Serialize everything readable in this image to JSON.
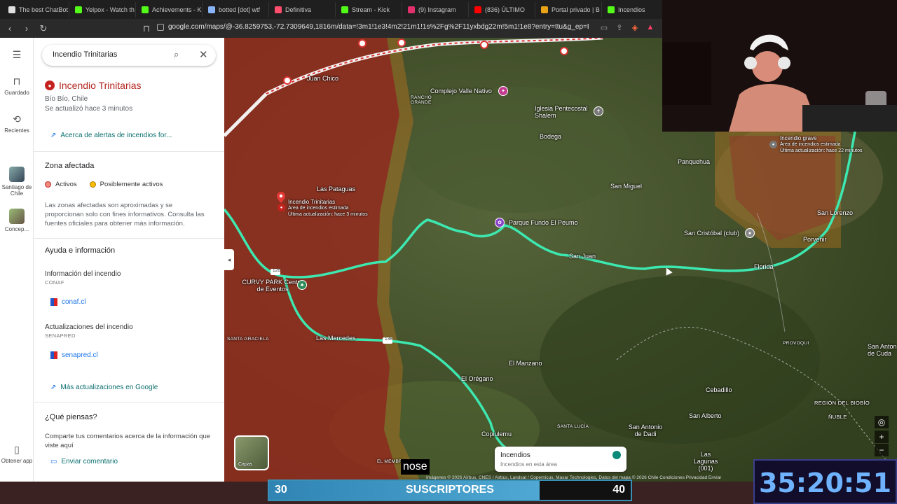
{
  "browser": {
    "tabs": [
      {
        "label": "The best ChatBot",
        "color": "#e0e0e0"
      },
      {
        "label": "Yelpox - Watch th",
        "color": "#53fc18"
      },
      {
        "label": "Achievements - K",
        "color": "#53fc18"
      },
      {
        "label": "botted [dot] wtf",
        "color": "#8ab4f8"
      },
      {
        "label": "Definitiva",
        "color": "#ff4d6d"
      },
      {
        "label": "Stream - Kick",
        "color": "#53fc18"
      },
      {
        "label": "(9) Instagram",
        "color": "#e1306c"
      },
      {
        "label": "(836) ÚLTIMO",
        "color": "#ff0000"
      },
      {
        "label": "Portal privado | B",
        "color": "#e8a317"
      },
      {
        "label": "Incendios",
        "color": "#53fc18"
      }
    ],
    "url": "google.com/maps/@-36.8259753,-72.7309649,1816m/data=!3m1!1e3!4m2!21m1!1s%2Fg%2F11yxbdg22m!5m1!1e8?entry=ttu&g_ep=EgoyMD..."
  },
  "rail": {
    "saved": "Guardado",
    "recent": "Recientes",
    "place1": "Santiago de Chile",
    "place2": "Concep...",
    "get_app": "Obtener app"
  },
  "panel": {
    "search_value": "Incendio Trinitarias",
    "title": "Incendio Trinitarias",
    "region": "Bío Bío, Chile",
    "updated": "Se actualizó hace 3 minutos",
    "about_link": "Acerca de alertas de incendios for...",
    "zone_heading": "Zona afectada",
    "legend_active": "Activos",
    "legend_possible": "Posiblemente activos",
    "disclaimer": "Las zonas afectadas son aproximadas y se proporcionan solo con fines informativos. Consulta las fuentes oficiales para obtener más información.",
    "help_heading": "Ayuda e información",
    "info1_title": "Información del incendio",
    "info1_src": "CONAF",
    "info1_link": "conaf.cl",
    "info2_title": "Actualizaciones del incendio",
    "info2_src": "SENAPRED",
    "info2_link": "senapred.cl",
    "more_updates": "Más actualizaciones en Google",
    "feedback_heading": "¿Qué piensas?",
    "feedback_text": "Comparte tus comentarios acerca de la información que viste aquí",
    "feedback_link": "Enviar comentario"
  },
  "map": {
    "labels": {
      "juan_chico": "Juan Chico",
      "rancho_grande": "RANCHO GRANDE",
      "complejo": "Complejo Valle Nativo",
      "iglesia": "Iglesia Pentecostal Shalem",
      "bodega": "Bodega",
      "panquehua": "Panquehua",
      "san_miguel": "San Miguel",
      "las_pataguas": "Las Pataguas",
      "parque": "Parque Fundo El Peumo",
      "san_juan": "San Juan",
      "florida": "Florida",
      "san_cristobal": "San Cristóbal (club)",
      "porvenir": "Porvenir",
      "san_lorenzo": "San Lorenzo",
      "curvy_park": "CURVY PARK Centro de Eventos",
      "santa_graciela": "SANTA GRACIELA",
      "las_mercedes": "Las Mercedes",
      "el_manzano": "El Manzano",
      "el_oregano": "El Orégano",
      "provoqui": "PROVOQUI",
      "san_antonio_cuda": "San Anton de Cuda",
      "cebadillo": "Cebadillo",
      "copiulemu": "Copiulemu",
      "santa_lucia": "SANTA LUCÍA",
      "san_antonio_dadi": "San Antonio de Dadi",
      "san_alberto": "San Alberto",
      "las_lagunas": "Las Lagunas (001)",
      "region_biobio": "REGIÓN DEL BIOBÍO",
      "nuble": "ÑUBLE",
      "el_membrillo": "EL MEMBR",
      "road_126": "126",
      "road_136": "136"
    },
    "fire_marker": {
      "name": "Incendio Trinitarias",
      "detail": "Área de incendios estimada",
      "updated": "Última actualización: hace 3 minutos"
    },
    "fire_grave": {
      "name": "Incendio grave",
      "detail": "Área de incendios estimada",
      "updated": "Última actualización: hace 22 minutos"
    },
    "layers_label": "Capas",
    "incendios_card": {
      "title": "Incendios",
      "subtitle": "Incendios en esta área"
    },
    "attribution": "Imágenes © 2026 Airbus, CNES / Airbus, Landsat / Copernicus, Maxar Technologies, Datos del mapa © 2026   Chile   Condiciones   Privacidad   Enviar"
  },
  "overlay": {
    "sub_current": "30",
    "sub_label": "SUSCRIPTORES",
    "sub_goal": "40",
    "timer": "35:20:51",
    "caption": "nose"
  },
  "colors": {
    "fire_active": "#c5221f",
    "fire_possible": "#e8a317",
    "route": "#3de8b0",
    "link": "#1a73e8"
  }
}
